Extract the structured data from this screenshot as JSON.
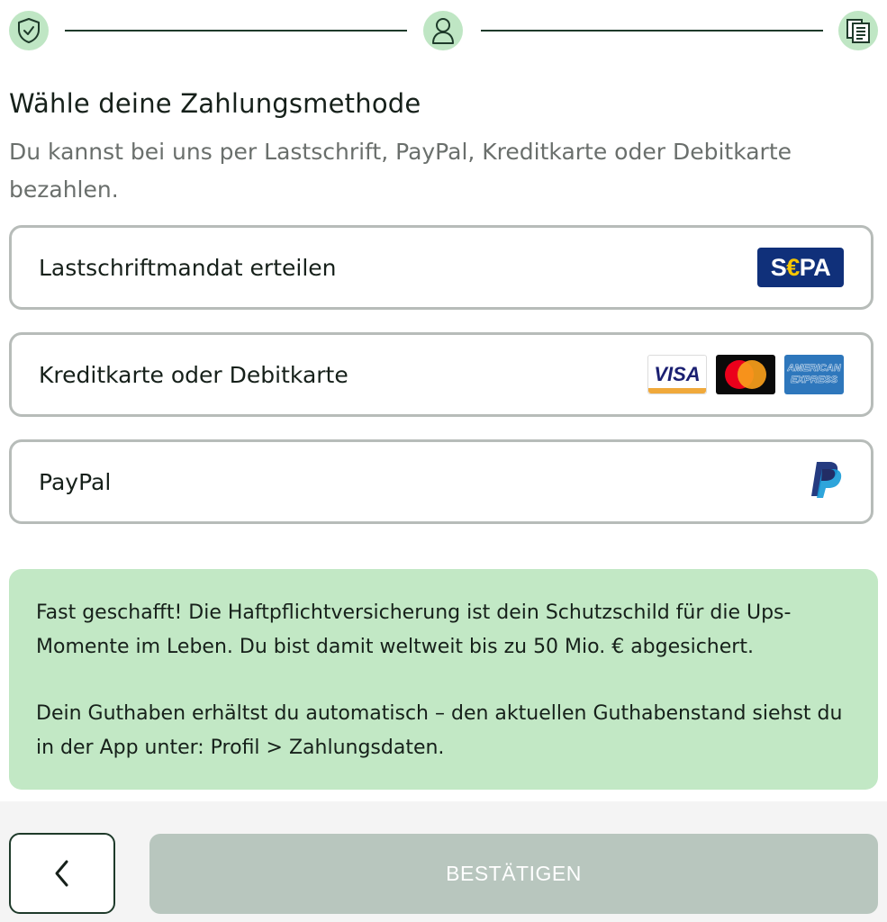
{
  "stepper": {
    "steps": [
      {
        "icon": "shield-check-icon",
        "state": "done"
      },
      {
        "icon": "user-icon",
        "state": "done"
      },
      {
        "icon": "document-icon",
        "state": "current"
      }
    ]
  },
  "page": {
    "title": "Wähle deine Zahlungsmethode",
    "subtitle": "Du kannst bei uns per Lastschrift, PayPal, Kreditkarte oder Debitkarte bezahlen."
  },
  "payment_options": [
    {
      "label": "Lastschriftmandat erteilen",
      "logos": [
        "sepa-logo"
      ]
    },
    {
      "label": "Kreditkarte oder Debitkarte",
      "logos": [
        "visa-logo",
        "mastercard-logo",
        "amex-logo"
      ]
    },
    {
      "label": "PayPal",
      "logos": [
        "paypal-logo"
      ]
    }
  ],
  "logos": {
    "sepa": "SEPA",
    "visa": "VISA",
    "amex_line1": "AMERICAN",
    "amex_line2": "EXPRESS"
  },
  "info": {
    "paragraph1": "Fast geschafft! Die Haftpflichtversicherung ist dein Schutzschild für die Ups-Momente im Leben. Du bist damit weltweit bis zu 50 Mio. € abgesichert.",
    "paragraph2": "Dein Guthaben erhältst du automatisch – den aktuellen Guthabenstand siehst du in der App unter: Profil > Zahlungsdaten."
  },
  "footer": {
    "back_icon": "chevron-left-icon",
    "confirm_label": "BESTÄTIGEN"
  },
  "colors": {
    "accent_green": "#c2e8c5",
    "dark_green": "#1e3a2a",
    "disabled_button": "#b8c6be",
    "sepa_blue": "#10307a",
    "paypal_dark": "#253b80",
    "paypal_light": "#179bd7"
  }
}
